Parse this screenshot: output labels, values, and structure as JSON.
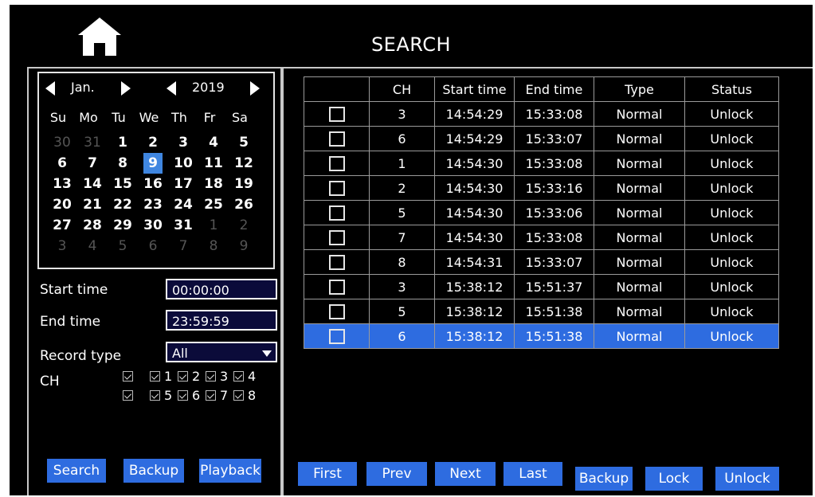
{
  "header": {
    "title": "SEARCH",
    "home_icon": "home-icon"
  },
  "calendar": {
    "month": "Jan.",
    "year": "2019",
    "weekdays": [
      "Su",
      "Mo",
      "Tu",
      "We",
      "Th",
      "Fr",
      "Sa"
    ],
    "weeks": [
      [
        "30",
        "31",
        "1",
        "2",
        "3",
        "4",
        "5"
      ],
      [
        "6",
        "7",
        "8",
        "9",
        "10",
        "11",
        "12"
      ],
      [
        "13",
        "14",
        "15",
        "16",
        "17",
        "18",
        "19"
      ],
      [
        "20",
        "21",
        "22",
        "23",
        "24",
        "25",
        "26"
      ],
      [
        "27",
        "28",
        "29",
        "30",
        "31",
        "1",
        "2"
      ],
      [
        "3",
        "4",
        "5",
        "6",
        "7",
        "8",
        "9"
      ]
    ],
    "selected_day": "9"
  },
  "filters": {
    "start_time_label": "Start time",
    "start_time_value": "00:00:00",
    "end_time_label": "End time",
    "end_time_value": "23:59:59",
    "record_type_label": "Record type",
    "record_type_value": "All",
    "ch_label": "CH",
    "channels": [
      "1",
      "2",
      "3",
      "4",
      "5",
      "6",
      "7",
      "8"
    ]
  },
  "left_buttons": {
    "search": "Search",
    "backup": "Backup",
    "playback": "Playback"
  },
  "table": {
    "headers": [
      "",
      "CH",
      "Start time",
      "End time",
      "Type",
      "Status"
    ],
    "rows": [
      {
        "ch": "3",
        "start": "14:54:29",
        "end": "15:33:08",
        "type": "Normal",
        "status": "Unlock"
      },
      {
        "ch": "6",
        "start": "14:54:29",
        "end": "15:33:07",
        "type": "Normal",
        "status": "Unlock"
      },
      {
        "ch": "1",
        "start": "14:54:30",
        "end": "15:33:08",
        "type": "Normal",
        "status": "Unlock"
      },
      {
        "ch": "2",
        "start": "14:54:30",
        "end": "15:33:16",
        "type": "Normal",
        "status": "Unlock"
      },
      {
        "ch": "5",
        "start": "14:54:30",
        "end": "15:33:06",
        "type": "Normal",
        "status": "Unlock"
      },
      {
        "ch": "7",
        "start": "14:54:30",
        "end": "15:33:08",
        "type": "Normal",
        "status": "Unlock"
      },
      {
        "ch": "8",
        "start": "14:54:31",
        "end": "15:33:07",
        "type": "Normal",
        "status": "Unlock"
      },
      {
        "ch": "3",
        "start": "15:38:12",
        "end": "15:51:37",
        "type": "Normal",
        "status": "Unlock"
      },
      {
        "ch": "5",
        "start": "15:38:12",
        "end": "15:51:38",
        "type": "Normal",
        "status": "Unlock"
      },
      {
        "ch": "6",
        "start": "15:38:12",
        "end": "15:51:38",
        "type": "Normal",
        "status": "Unlock"
      }
    ],
    "selected_row": 9
  },
  "right_buttons": {
    "first": "First",
    "prev": "Prev",
    "next": "Next",
    "last": "Last",
    "backup": "Backup",
    "lock": "Lock",
    "unlock": "Unlock"
  },
  "colors": {
    "accent": "#2e6ce0",
    "selected_day": "#3f86e0",
    "background": "#000000",
    "input_bg": "#0b0b3a"
  }
}
